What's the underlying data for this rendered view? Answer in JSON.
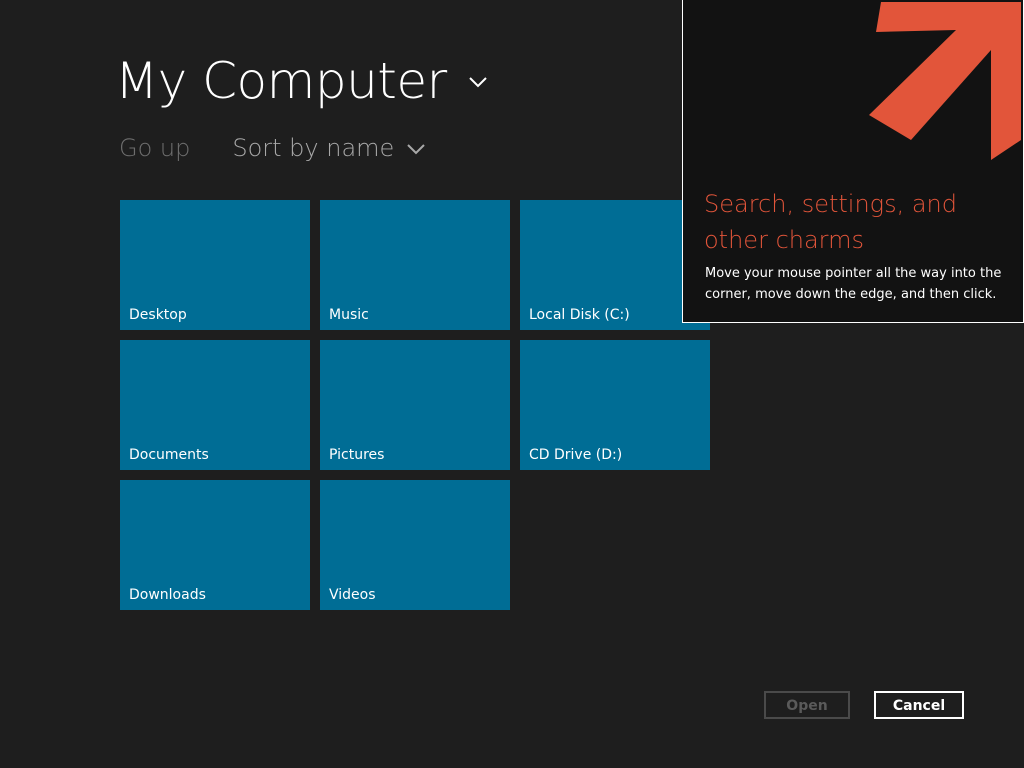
{
  "header": {
    "title": "My Computer",
    "go_up_label": "Go up",
    "sort_label": "Sort by name"
  },
  "tiles": [
    {
      "label": "Desktop"
    },
    {
      "label": "Music"
    },
    {
      "label": "Local Disk (C:)"
    },
    {
      "label": "Documents"
    },
    {
      "label": "Pictures"
    },
    {
      "label": "CD Drive (D:)"
    },
    {
      "label": "Downloads"
    },
    {
      "label": "Videos"
    }
  ],
  "tip": {
    "heading": "Search, settings, and other charms",
    "body": "Move your mouse pointer all the way into the corner, move down the edge, and then click.",
    "accent_color": "#e2553a"
  },
  "buttons": {
    "open_label": "Open",
    "cancel_label": "Cancel"
  },
  "colors": {
    "background": "#1e1e1e",
    "tile": "#006d95",
    "tip_background": "#121212",
    "arrow": "#e2553a"
  },
  "icons": {
    "title_dropdown": "chevron-down-icon",
    "sort_dropdown": "chevron-down-icon",
    "charms_hint": "arrow-up-right-icon"
  }
}
